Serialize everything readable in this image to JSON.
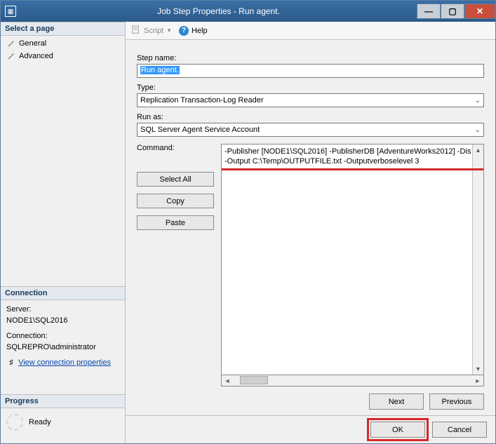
{
  "window": {
    "title": "Job Step Properties - Run agent."
  },
  "titlebar_icons": {
    "min": "—",
    "max": "▢",
    "close": "✕"
  },
  "sidebar": {
    "select_page_title": "Select a page",
    "pages": [
      {
        "label": "General"
      },
      {
        "label": "Advanced"
      }
    ],
    "connection_title": "Connection",
    "server_label": "Server:",
    "server_value": "NODE1\\SQL2016",
    "connection_label": "Connection:",
    "connection_value": "SQLREPRO\\administrator",
    "view_connection_link": "View connection properties",
    "progress_title": "Progress",
    "progress_status": "Ready"
  },
  "toolbar": {
    "script_label": "Script",
    "help_label": "Help"
  },
  "form": {
    "step_name_label": "Step name:",
    "step_name_value": "Run agent.",
    "type_label": "Type:",
    "type_value": "Replication Transaction-Log Reader",
    "run_as_label": "Run as:",
    "run_as_value": "SQL Server Agent Service Account",
    "command_label": "Command:",
    "command_text_line1": "-Publisher [NODE1\\SQL2016] -PublisherDB [AdventureWorks2012] -Dis",
    "command_text_line2": "-Output C:\\Temp\\OUTPUTFILE.txt -Outputverboselevel 3",
    "btn_select_all": "Select All",
    "btn_copy": "Copy",
    "btn_paste": "Paste",
    "btn_next": "Next",
    "btn_previous": "Previous"
  },
  "footer": {
    "ok": "OK",
    "cancel": "Cancel"
  }
}
